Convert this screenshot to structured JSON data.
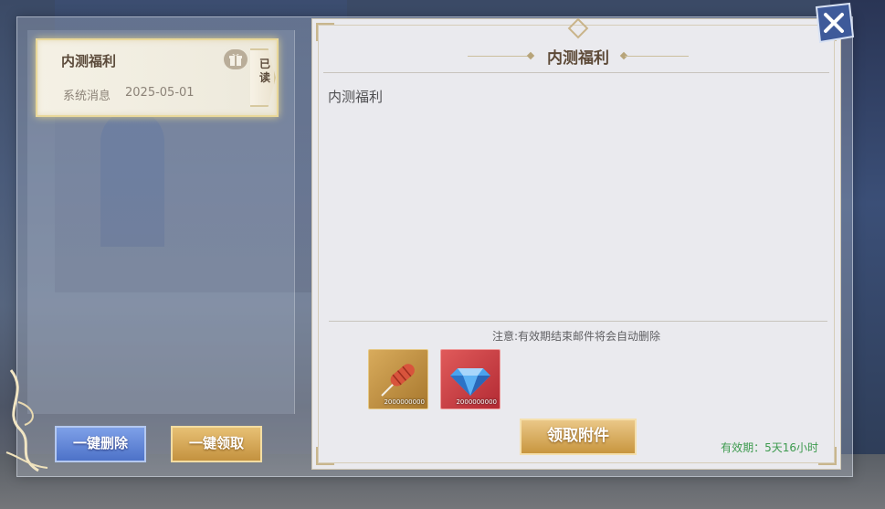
{
  "mail_list": {
    "items": [
      {
        "title": "内测福利",
        "sender": "系统消息",
        "date": "2025-05-01",
        "status": "已读",
        "icon": "gift-icon"
      }
    ],
    "delete_all_label": "一键删除",
    "collect_all_label": "一键领取"
  },
  "detail": {
    "title": "内测福利",
    "body": "内测福利",
    "notice": "注意:有效期结束邮件将会自动删除",
    "attachments": [
      {
        "icon": "sausage-icon",
        "count": "2000000000"
      },
      {
        "icon": "diamond-icon",
        "count": "2000000000"
      }
    ],
    "claim_label": "领取附件",
    "validity_label": "有效期：",
    "validity_value": "5天16小时"
  },
  "colors": {
    "accent_gold": "#c8963f",
    "accent_blue": "#4d72c8",
    "validity_green": "#3d9a4e"
  }
}
